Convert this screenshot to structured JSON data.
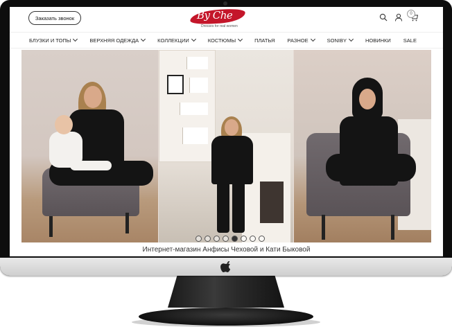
{
  "header": {
    "call_button": "Заказать звонок",
    "logo_text": "By Che",
    "logo_tagline": "Dresses for real women",
    "cart_count": "0"
  },
  "nav": {
    "items": [
      {
        "label": "БЛУЗКИ И ТОПЫ",
        "has_dropdown": true
      },
      {
        "label": "ВЕРХНЯЯ ОДЕЖДА",
        "has_dropdown": true
      },
      {
        "label": "КОЛЛЕКЦИИ",
        "has_dropdown": true
      },
      {
        "label": "КОСТЮМЫ",
        "has_dropdown": true
      },
      {
        "label": "ПЛАТЬЯ",
        "has_dropdown": false
      },
      {
        "label": "РАЗНОЕ",
        "has_dropdown": true
      },
      {
        "label": "SONIBY",
        "has_dropdown": true
      },
      {
        "label": "НОВИНКИ",
        "has_dropdown": false
      },
      {
        "label": "SALE",
        "has_dropdown": false
      }
    ]
  },
  "slider": {
    "slide_count": 8,
    "active_index": 4
  },
  "caption": "Интернет-магазин Анфисы Чеховой и Кати Быковой",
  "colors": {
    "brand": "#c4162a",
    "monitor_frame": "#0d0d0d"
  }
}
